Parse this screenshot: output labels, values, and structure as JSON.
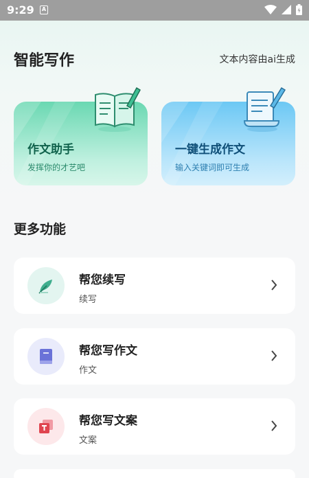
{
  "status_bar": {
    "time": "9:29",
    "notification": "A"
  },
  "header": {
    "title": "智能写作",
    "ai_note": "文本内容由ai生成"
  },
  "feature_cards": [
    {
      "title": "作文助手",
      "subtitle": "发挥你的才艺吧",
      "icon": "open-book-pen-icon",
      "color": "#6ad8b2"
    },
    {
      "title": "一键生成作文",
      "subtitle": "输入关键词即可生成",
      "icon": "scroll-pen-icon",
      "color": "#6cc8f4"
    }
  ],
  "more_section": {
    "title": "更多功能"
  },
  "functions": [
    {
      "title": "帮您续写",
      "subtitle": "续写",
      "icon": "feather-icon",
      "color": "#e3f5f0"
    },
    {
      "title": "帮您写作文",
      "subtitle": "作文",
      "icon": "book-icon",
      "color": "#e9ebfb"
    },
    {
      "title": "帮您写文案",
      "subtitle": "文案",
      "icon": "copy-text-icon",
      "color": "#fde8ea"
    }
  ]
}
